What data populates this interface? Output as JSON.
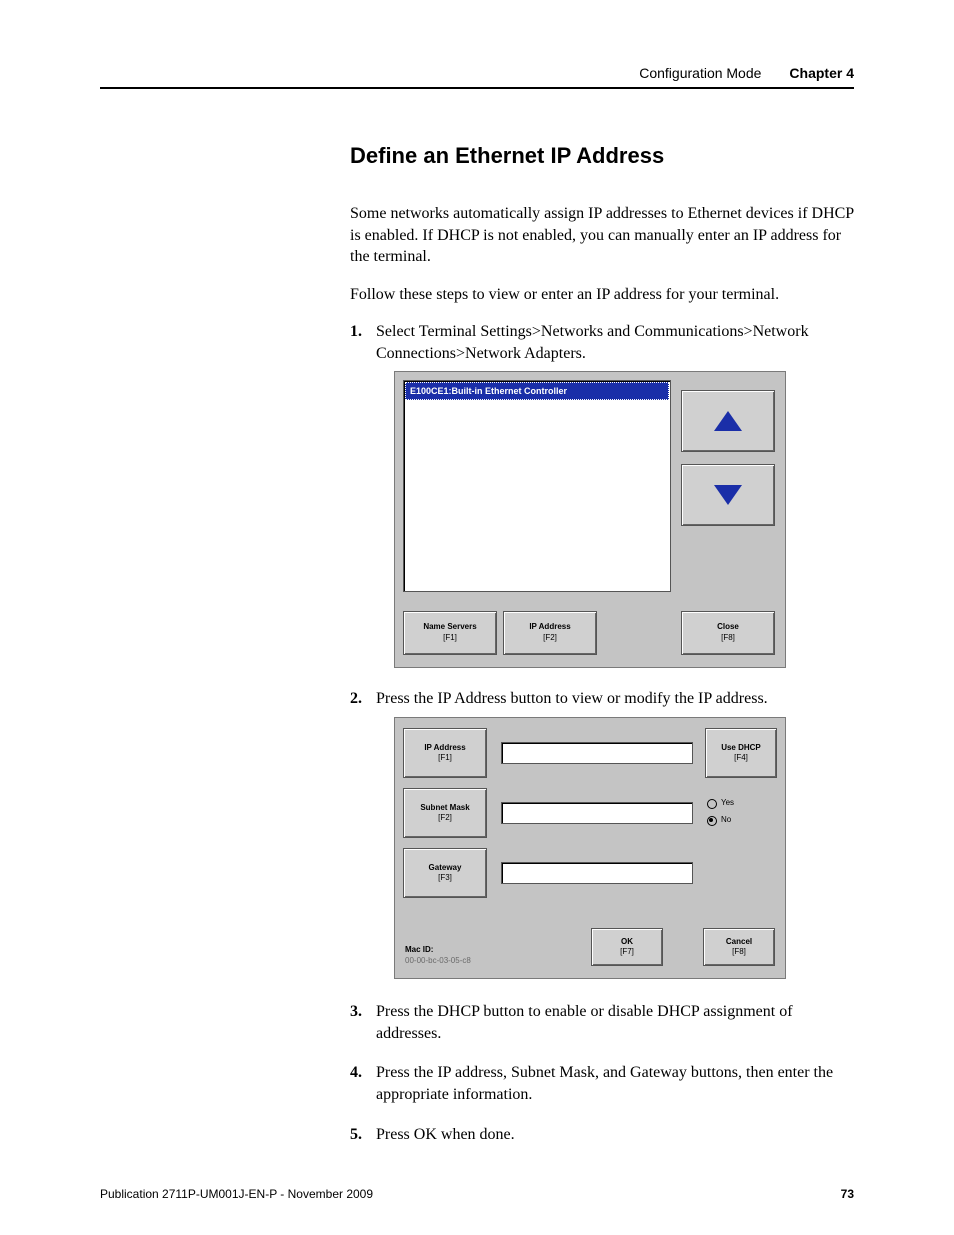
{
  "header": {
    "section": "Configuration Mode",
    "chapter": "Chapter 4"
  },
  "title": "Define an Ethernet IP Address",
  "para1": "Some networks automatically assign IP addresses to Ethernet devices if DHCP is enabled. If DHCP is not enabled, you can manually enter an IP address for the terminal.",
  "para2": "Follow these steps to view or enter an IP address for your terminal.",
  "steps": {
    "s1": {
      "num": "1.",
      "text": "Select Terminal Settings>Networks and Communications>Network Connections>Network Adapters."
    },
    "s2": {
      "num": "2.",
      "text": "Press the IP Address button to view or modify the IP address."
    },
    "s3": {
      "num": "3.",
      "text": "Press the DHCP button to enable or disable DHCP assignment of addresses."
    },
    "s4": {
      "num": "4.",
      "text": "Press the IP address, Subnet Mask, and Gateway buttons, then enter the appropriate information."
    },
    "s5": {
      "num": "5.",
      "text": "Press OK when done."
    }
  },
  "fig1": {
    "selected": "E100CE1:Built-in Ethernet Controller",
    "name_servers": {
      "l1": "Name Servers",
      "l2": "[F1]"
    },
    "ip_address": {
      "l1": "IP Address",
      "l2": "[F2]"
    },
    "close": {
      "l1": "Close",
      "l2": "[F8]"
    }
  },
  "fig2": {
    "ip": {
      "l1": "IP Address",
      "l2": "[F1]"
    },
    "subnet": {
      "l1": "Subnet Mask",
      "l2": "[F2]"
    },
    "gateway": {
      "l1": "Gateway",
      "l2": "[F3]"
    },
    "dhcp": {
      "l1": "Use DHCP",
      "l2": "[F4]"
    },
    "yes": "Yes",
    "no": "No",
    "mac_label": "Mac ID:",
    "mac_value": "00-00-bc-03-05-c8",
    "ok": {
      "l1": "OK",
      "l2": "[F7]"
    },
    "cancel": {
      "l1": "Cancel",
      "l2": "[F8]"
    }
  },
  "footer": {
    "pub": "Publication 2711P-UM001J-EN-P - November 2009",
    "page": "73"
  }
}
